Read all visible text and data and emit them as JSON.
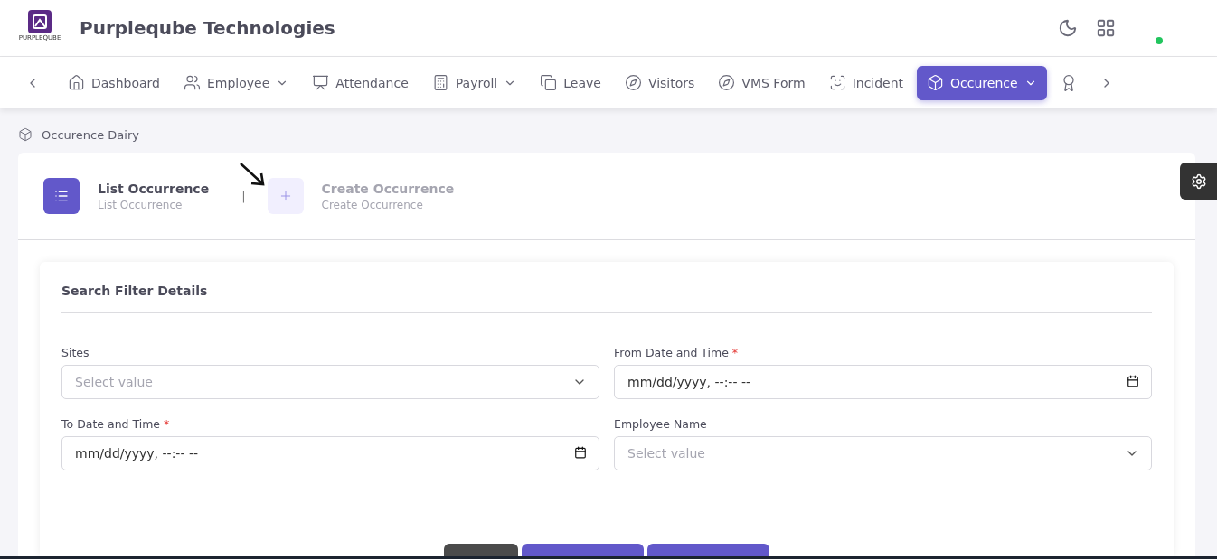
{
  "header": {
    "logo_text": "PURPLEQUBE",
    "company": "Purpleqube Technologies",
    "online": true
  },
  "nav": [
    {
      "label": "Dashboard",
      "dropdown": false,
      "selected": false
    },
    {
      "label": "Employee",
      "dropdown": true,
      "selected": false
    },
    {
      "label": "Attendance",
      "dropdown": false,
      "selected": false
    },
    {
      "label": "Payroll",
      "dropdown": true,
      "selected": false
    },
    {
      "label": "Leave",
      "dropdown": false,
      "selected": false
    },
    {
      "label": "Visitors",
      "dropdown": false,
      "selected": false
    },
    {
      "label": "VMS Form",
      "dropdown": false,
      "selected": false
    },
    {
      "label": "Incident",
      "dropdown": false,
      "selected": false
    },
    {
      "label": "Occurence",
      "dropdown": true,
      "selected": true
    }
  ],
  "breadcrumb": "Occurence Dairy",
  "steps": [
    {
      "title": "List Occurrence",
      "subtitle": "List Occurrence",
      "selected": true
    },
    {
      "title": "Create Occurrence",
      "subtitle": "Create Occurrence",
      "selected": false
    }
  ],
  "step_separator": "|",
  "filter": {
    "title": "Search Filter Details",
    "fields": [
      {
        "kind": "select",
        "label": "Sites",
        "required": false,
        "placeholder": "Select value"
      },
      {
        "kind": "datetime",
        "label": "From Date and Time",
        "required": true,
        "placeholder": "mm/dd/yyyy, --:-- --"
      },
      {
        "kind": "datetime",
        "label": "To Date and Time",
        "required": true,
        "placeholder": "mm/dd/yyyy, --:-- --"
      },
      {
        "kind": "select",
        "label": "Employee Name",
        "required": false,
        "placeholder": "Select value"
      }
    ],
    "required_mark": "*",
    "buttons": [
      {
        "kind": "dark"
      },
      {
        "kind": "primary"
      },
      {
        "kind": "primary"
      }
    ]
  }
}
